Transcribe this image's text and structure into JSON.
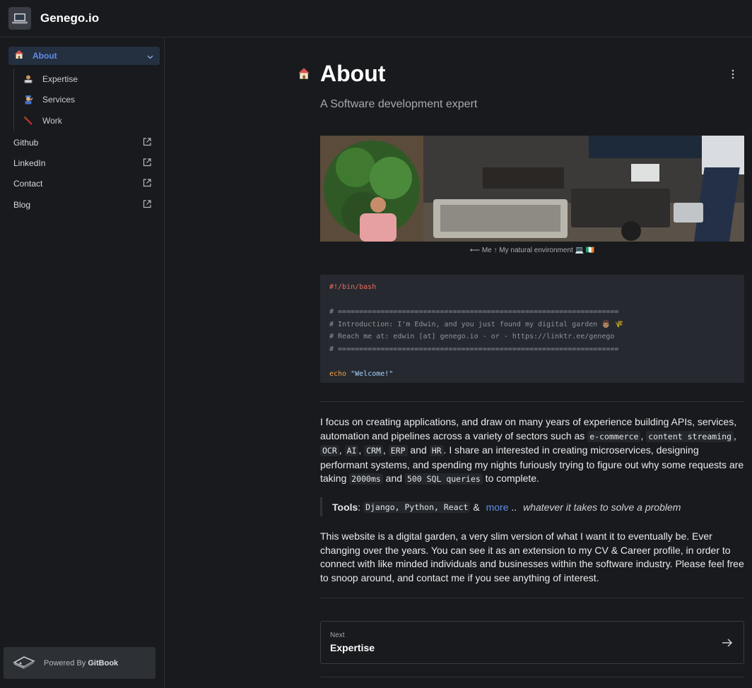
{
  "site": {
    "title": "Genego.io",
    "logo_icon": "laptop-icon"
  },
  "sidebar": {
    "active": {
      "label": "About",
      "icon": "house-icon"
    },
    "subitems": [
      {
        "label": "Expertise",
        "icon": "technologist-icon"
      },
      {
        "label": "Services",
        "icon": "mechanic-icon"
      },
      {
        "label": "Work",
        "icon": "saw-icon"
      }
    ],
    "links": [
      {
        "label": "Github",
        "icon": "external-link-icon"
      },
      {
        "label": "LinkedIn",
        "icon": "external-link-icon"
      },
      {
        "label": "Contact",
        "icon": "external-link-icon"
      },
      {
        "label": "Blog",
        "icon": "external-link-icon"
      }
    ],
    "powered": {
      "prefix": "Powered By",
      "brand": "GitBook"
    }
  },
  "page": {
    "title": "About",
    "subtitle": "A Software development expert",
    "caption": "⟵ Me ↑ My natural environment 💻 🇮🇪",
    "code": {
      "shebang": "#!/bin/bash",
      "c1": "# ==================================================================",
      "c2": "# Introduction: I'm Edwin, and you just found my digital garden 👨🏽 🌾",
      "c3": "# Reach me at: edwin [at] genego.io - or - https://linktr.ee/genego",
      "c4": "# ==================================================================",
      "kw": "echo",
      "str": "\"Welcome!\""
    },
    "p1": {
      "t1": "I focus on creating applications, and draw on many years of experience building APIs, services, automation and pipelines across a variety of sectors such as ",
      "k1": "e-commerce",
      "t2": ", ",
      "k2": "content streaming",
      "t3": ", ",
      "k3": "OCR",
      "t4": ", ",
      "k4": "AI",
      "t5": ", ",
      "k5": "CRM",
      "t6": ", ",
      "k6": "ERP",
      "t7": " and ",
      "k7": "HR",
      "t8": ". I share an interested in creating microservices, designing performant systems, and spending my nights furiously trying to figure out why some requests are taking ",
      "k8": "2000ms",
      "t9": " and ",
      "k9": "500 SQL queries",
      "t10": " to complete."
    },
    "tools": {
      "label": "Tools",
      "colon": ": ",
      "code": "Django, Python, React",
      "amp": " & ",
      "more": "more",
      "dots": " .. ",
      "tail": "whatever it takes to solve a problem"
    },
    "p2": "This website is a digital garden, a very slim version of what I want it to eventually be. Ever changing over the years. You can see it as an extension to my CV & Career profile, in order to connect with like minded individuals and businesses within the software industry. Please feel free to snoop around, and contact me if you see anything of interest.",
    "next": {
      "small": "Next",
      "title": "Expertise"
    }
  },
  "colors": {
    "accent": "#5f8de6",
    "bg": "#181a1d",
    "panel": "#262a30"
  }
}
